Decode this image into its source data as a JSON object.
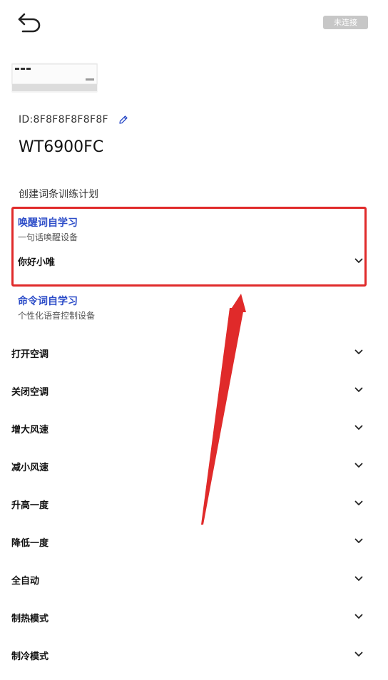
{
  "header": {
    "back_icon": "undo-back-icon",
    "status": "未连接"
  },
  "device": {
    "image": "air-conditioner-unit",
    "id": "ID:8F8F8F8F8F8F",
    "edit_icon": "pencil-icon",
    "model": "WT6900FC"
  },
  "section_title": "创建词条训练计划",
  "wake": {
    "title": "唤醒词自学习",
    "subtitle": "一句话唤醒设备",
    "selected": "你好小唯"
  },
  "command": {
    "title": "命令词自学习",
    "subtitle": "个性化语音控制设备",
    "items": [
      "打开空调",
      "关闭空调",
      "增大风速",
      "减小风速",
      "升高一度",
      "降低一度",
      "全自动",
      "制热模式",
      "制冷模式"
    ]
  },
  "colors": {
    "accent_blue": "#2d4dc8",
    "annotation_red": "#e02a2a",
    "badge_grey": "#c7c7c7"
  }
}
